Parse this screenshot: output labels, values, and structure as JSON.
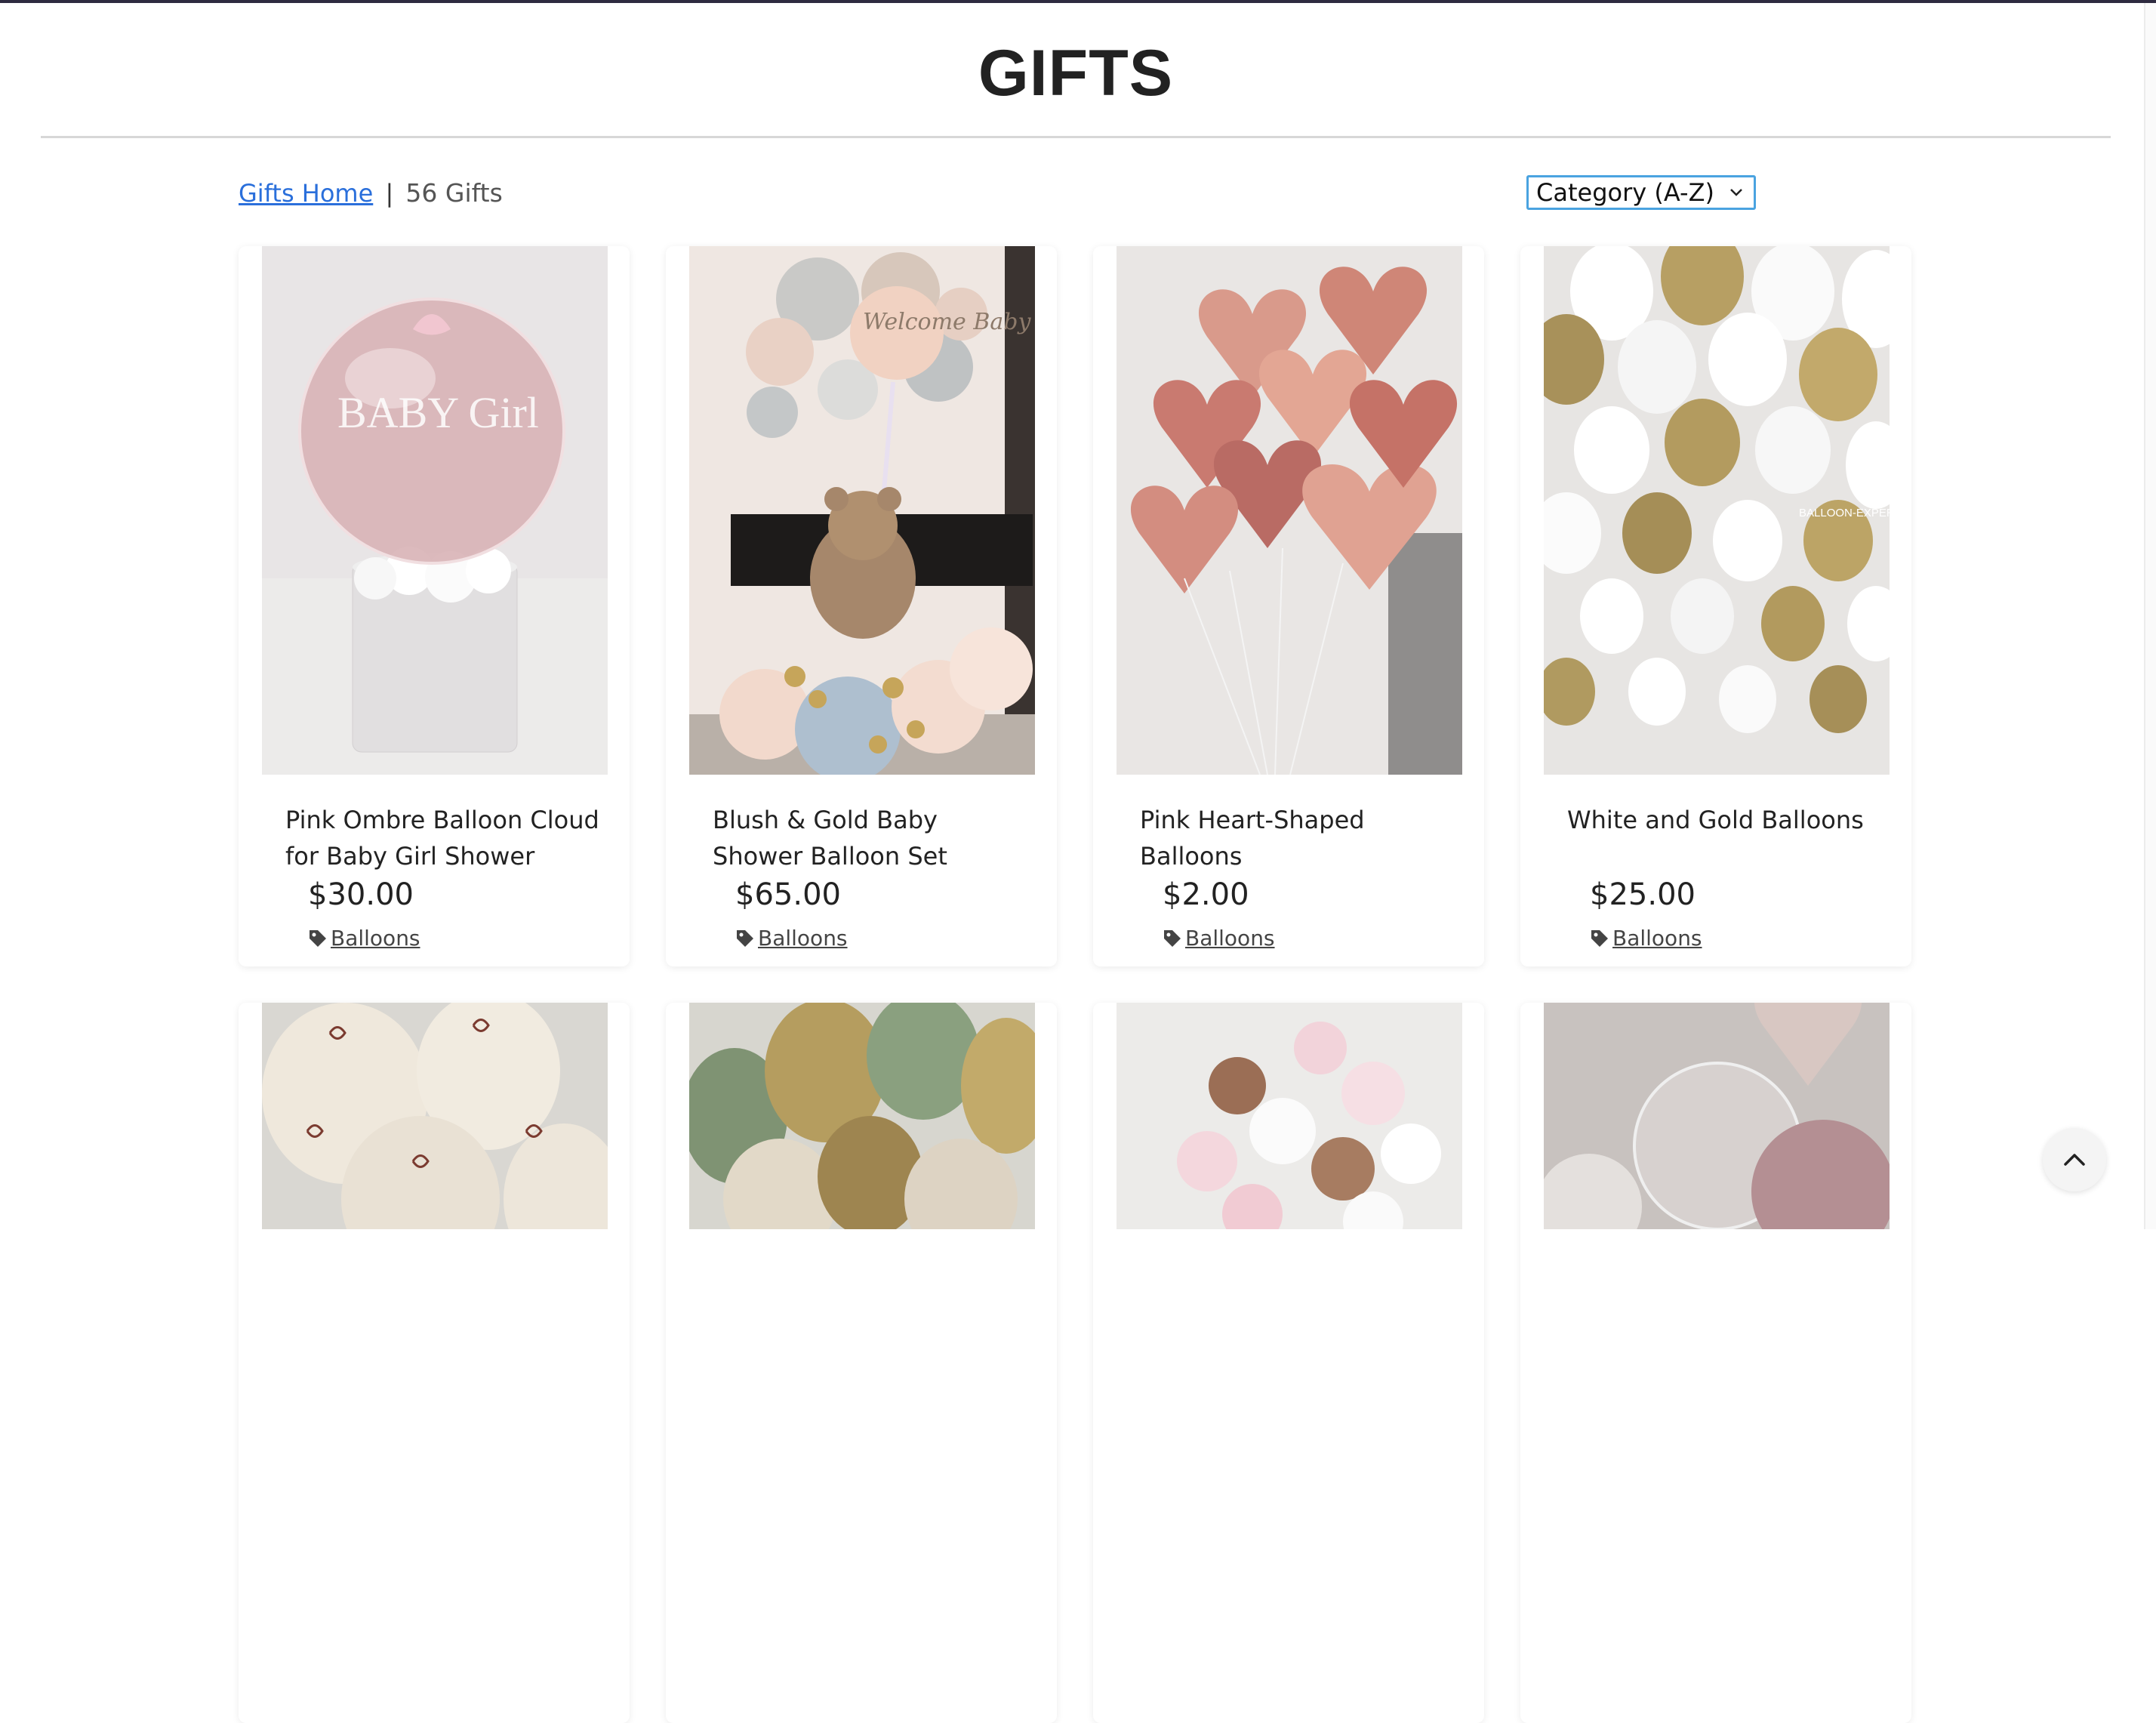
{
  "page": {
    "title": "GIFTS"
  },
  "toolbar": {
    "breadcrumb_link": "Gifts Home",
    "separator": "|",
    "count": "56 Gifts",
    "sort_selected": "Category (A-Z)"
  },
  "products": [
    {
      "name": "Pink Ombre Balloon Cloud for Baby Girl Shower",
      "price": "$30.00",
      "category": "Balloons",
      "image_text": "BABY Girl"
    },
    {
      "name": "Blush & Gold Baby Shower Balloon Set",
      "price": "$65.00",
      "category": "Balloons",
      "image_text": "Welcome Baby"
    },
    {
      "name": "Pink Heart-Shaped Balloons",
      "price": "$2.00",
      "category": "Balloons"
    },
    {
      "name": "White and Gold Balloons",
      "price": "$25.00",
      "category": "Balloons",
      "image_text": "BALLOON-EXPER"
    }
  ],
  "icons": {
    "tag": "tag-icon",
    "to_top": "chevron-up-icon",
    "dropdown": "chevron-down-icon"
  }
}
